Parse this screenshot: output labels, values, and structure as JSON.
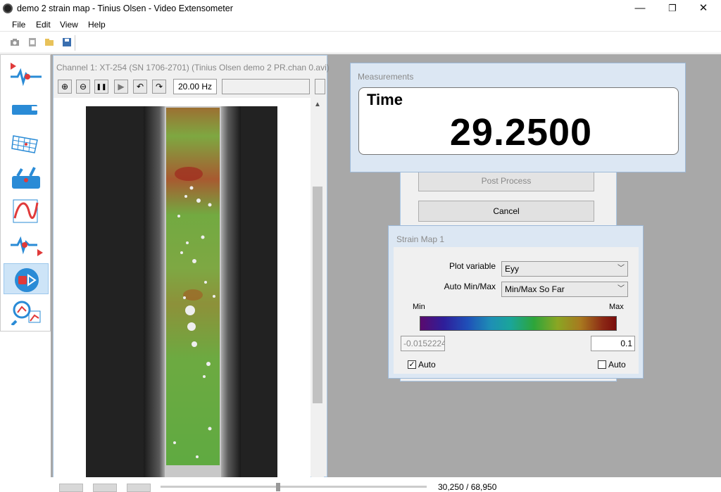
{
  "window": {
    "title": "demo 2 strain map - Tinius Olsen - Video Extensometer",
    "minimize": "—",
    "maximize": "❐",
    "close": "✕"
  },
  "menu": [
    "File",
    "Edit",
    "View",
    "Help"
  ],
  "channel": {
    "title": "Channel 1: XT-254 (SN 1706-2701) (Tinius Olsen demo 2 PR.chan 0.avi)",
    "rate": "20.00 Hz",
    "buttons": {
      "zoom_in": "⊕",
      "zoom_out": "⊖",
      "pause": "❚❚",
      "play": "▶",
      "undo": "↶",
      "redo": "↷"
    }
  },
  "measurements": {
    "title": "Measurements",
    "label": "Time",
    "value": "29.2500"
  },
  "post_process": {
    "post_process_label": "Post Process",
    "cancel_label": "Cancel"
  },
  "strain_map": {
    "title": "Strain Map 1",
    "plot_variable_label": "Plot variable",
    "plot_variable_value": "Eyy",
    "auto_minmax_label": "Auto Min/Max",
    "auto_minmax_value": "Min/Max So Far",
    "min_label": "Min",
    "max_label": "Max",
    "min_value": "-0.0152224",
    "max_value": "0.1",
    "auto_label": "Auto",
    "min_auto_checked": true,
    "max_auto_checked": false
  },
  "playback": {
    "frame_readout": "30,250 / 68,950"
  },
  "colors": {
    "accent": "#cde4f7",
    "record_red": "#e03a3a",
    "icon_blue": "#2a8bd6"
  }
}
